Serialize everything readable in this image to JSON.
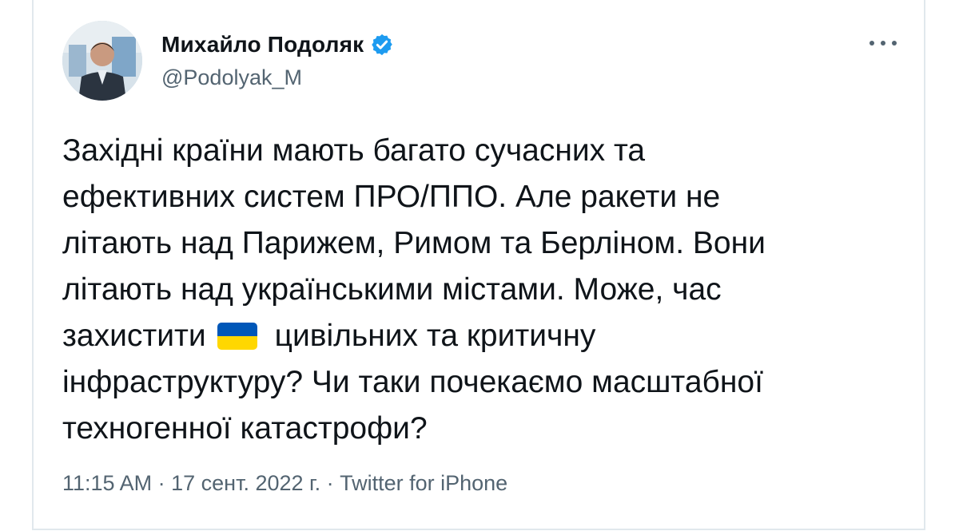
{
  "tweet": {
    "author": {
      "display_name": "Михайло Подоляк",
      "handle": "@Podolyak_M",
      "verified": true,
      "avatar_icon": "profile-photo"
    },
    "text_lines": {
      "l1": "Західні країни мають багато сучасних та",
      "l2": "ефективних систем ПРО/ППО. Але ракети не",
      "l3": "літають над Парижем, Римом та Берліном. Вони",
      "l4": "літають над українськими містами. Може, час",
      "l5a": "захистити",
      "l5_emoji": "ukraine-flag",
      "l5b": "цивільних та критичну",
      "l6": "інфраструктуру? Чи таки почекаємо масштабної",
      "l7": "техногенної катастрофи?"
    },
    "meta": {
      "time": "11:15 AM",
      "date": "17 сент. 2022 г.",
      "source": "Twitter for iPhone",
      "separator": "·"
    }
  },
  "colors": {
    "text": "#0f1419",
    "secondary": "#536471",
    "verified_blue": "#1d9bf0",
    "flag_blue": "#0057b8",
    "flag_yellow": "#ffd700"
  }
}
